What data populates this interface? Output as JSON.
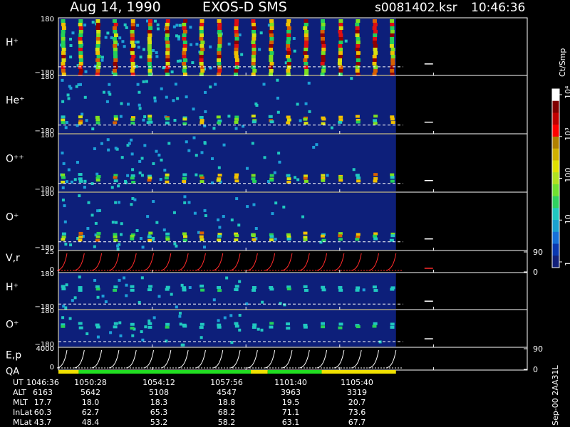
{
  "header": {
    "date": "Aug 14, 1990",
    "instrument": "EXOS-D SMS",
    "file": "s0081402.ksr",
    "time": "10:46:36"
  },
  "colorbar": {
    "unit": "Ct/Smp",
    "ticks": [
      {
        "label": "1",
        "value": 1
      },
      {
        "label": "10",
        "value": 10
      },
      {
        "label": "100",
        "value": 100
      },
      {
        "label": "10³",
        "value": 1000
      },
      {
        "label": "10⁴",
        "value": 10000
      }
    ]
  },
  "stamp": "Sep-00 2AA31L",
  "chart_data": {
    "type": "heatmap",
    "data_end_x": 0.72,
    "time_ticks_x": [
      0.0,
      0.2,
      0.4,
      0.6,
      0.8,
      1.0
    ],
    "dashed_line_marks": [
      0.35,
      0.21,
      0.23
    ],
    "panels": [
      {
        "label": "H⁺",
        "ymax": "180",
        "ymin": "−180",
        "kind": "spectro",
        "intensity": "high",
        "dashed_level": 0.85,
        "end_mark": true
      },
      {
        "label": "He⁺",
        "ymax": "180",
        "ymin": "−180",
        "kind": "spectro",
        "intensity": "medium",
        "dashed_level": 0.85,
        "end_mark": true
      },
      {
        "label": "O⁺⁺",
        "ymax": "180",
        "ymin": "−180",
        "kind": "spectro",
        "intensity": "medium",
        "dashed_level": 0.85,
        "end_mark": true
      },
      {
        "label": "O⁺",
        "ymax": "180",
        "ymin": "−180",
        "kind": "spectro",
        "intensity": "medium",
        "dashed_level": 0.85,
        "end_mark": true
      },
      {
        "label": "V,r",
        "ymax": "25",
        "ymin": "0",
        "kind": "line-red",
        "right_ticks": [
          "90",
          "0"
        ]
      },
      {
        "label": "H⁺",
        "ymax": "180",
        "ymin": "−180",
        "kind": "spectro",
        "intensity": "low",
        "dashed_level": 0.85,
        "end_mark": true
      },
      {
        "label": "O⁺",
        "ymax": "180",
        "ymin": "−180",
        "kind": "spectro",
        "intensity": "low",
        "dashed_level": 0.85,
        "end_mark": true
      },
      {
        "label": "E,p",
        "label2": "QA",
        "ymax": "4000",
        "ymin": "0",
        "kind": "line-white",
        "right_ticks": [
          "90",
          "0"
        ]
      }
    ],
    "qa_bar": [
      {
        "from": 0.0,
        "to": 0.06,
        "color": "#f0e000"
      },
      {
        "from": 0.06,
        "to": 0.57,
        "color": "#22dd22"
      },
      {
        "from": 0.57,
        "to": 0.62,
        "color": "#f0e000"
      },
      {
        "from": 0.62,
        "to": 0.78,
        "color": "#22dd22"
      },
      {
        "from": 0.78,
        "to": 1.0,
        "color": "#f0e000"
      }
    ],
    "table": {
      "rows": [
        {
          "label": "UT",
          "values": [
            "1046:36",
            "1050:28",
            "1054:12",
            "1057:56",
            "1101:40",
            "1105:40"
          ]
        },
        {
          "label": "ALT",
          "values": [
            "6163",
            "5642",
            "5108",
            "4547",
            "3963",
            "3319"
          ]
        },
        {
          "label": "MLT",
          "values": [
            "17.7",
            "18.0",
            "18.3",
            "18.8",
            "19.5",
            "20.7"
          ]
        },
        {
          "label": "InLat",
          "values": [
            "60.3",
            "62.7",
            "65.3",
            "68.2",
            "71.1",
            "73.6"
          ]
        },
        {
          "label": "MLat",
          "values": [
            "43.7",
            "48.4",
            "53.2",
            "58.2",
            "63.1",
            "67.7"
          ]
        }
      ]
    }
  }
}
